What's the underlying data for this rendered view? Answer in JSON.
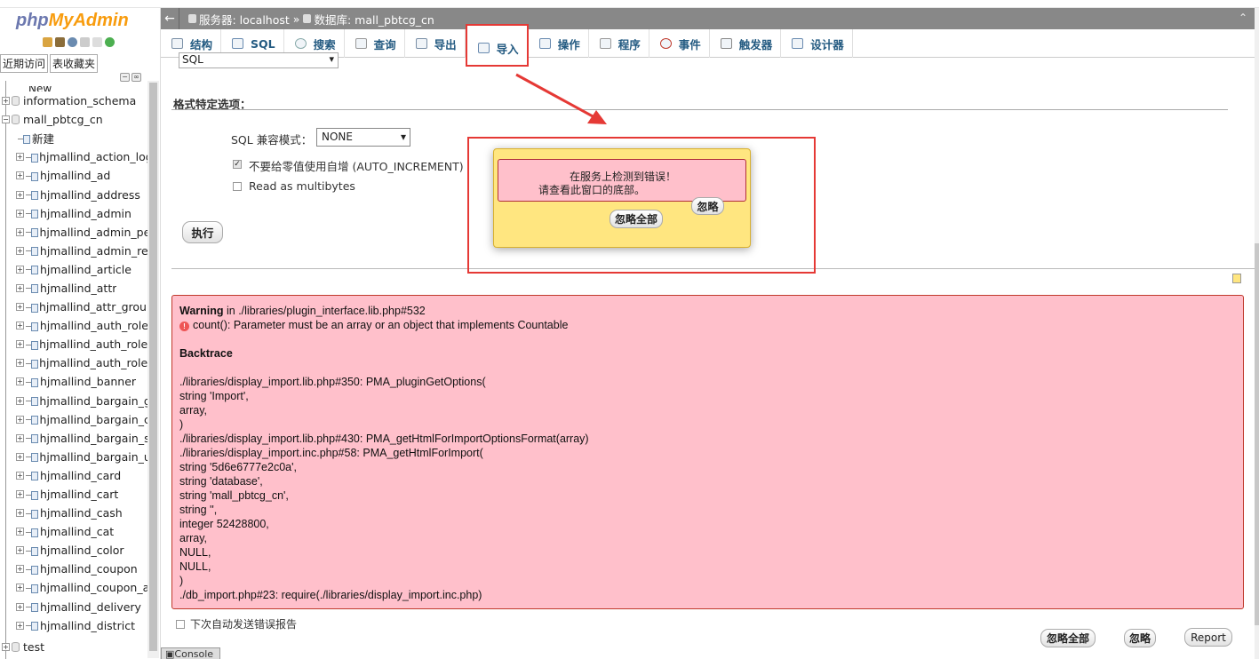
{
  "logo": {
    "php": "php",
    "my": "MyAdmin"
  },
  "colors": {
    "accent": "#235a81",
    "error_bg": "#ffc0cb",
    "popup_bg": "#ffe680",
    "highlight": "#e53935"
  },
  "sidebar": {
    "tabs": [
      "近期访问",
      "表收藏夹"
    ],
    "partial_top": "New",
    "db_info_schema": "information_schema",
    "db_current": "mall_pbtcg_cn",
    "new_label": "新建",
    "tables": [
      "hjmallind_action_log",
      "hjmallind_ad",
      "hjmallind_address",
      "hjmallind_admin",
      "hjmallind_admin_pe",
      "hjmallind_admin_re",
      "hjmallind_article",
      "hjmallind_attr",
      "hjmallind_attr_group",
      "hjmallind_auth_role",
      "hjmallind_auth_role_",
      "hjmallind_auth_role_",
      "hjmallind_banner",
      "hjmallind_bargain_g",
      "hjmallind_bargain_c",
      "hjmallind_bargain_s",
      "hjmallind_bargain_u",
      "hjmallind_card",
      "hjmallind_cart",
      "hjmallind_cash",
      "hjmallind_cat",
      "hjmallind_color",
      "hjmallind_coupon",
      "hjmallind_coupon_a",
      "hjmallind_delivery",
      "hjmallind_district"
    ],
    "db_test": "test"
  },
  "breadcrumb": {
    "server": "服务器: localhost",
    "sep": "»",
    "database": "数据库: mall_pbtcg_cn"
  },
  "tabs": [
    {
      "label": "结构",
      "icon": "structure-icon"
    },
    {
      "label": "SQL",
      "icon": "sql-icon"
    },
    {
      "label": "搜索",
      "icon": "search-icon"
    },
    {
      "label": "查询",
      "icon": "query-icon"
    },
    {
      "label": "导出",
      "icon": "export-icon"
    },
    {
      "label": "导入",
      "icon": "import-icon"
    },
    {
      "label": "操作",
      "icon": "wrench-icon"
    },
    {
      "label": "程序",
      "icon": "routines-icon"
    },
    {
      "label": "事件",
      "icon": "events-icon"
    },
    {
      "label": "触发器",
      "icon": "triggers-icon"
    },
    {
      "label": "设计器",
      "icon": "designer-icon"
    }
  ],
  "active_tab": "导入",
  "import": {
    "format_value": "SQL",
    "format_options_title": "格式特定选项：",
    "sql_compat_label": "SQL 兼容模式：",
    "sql_compat_value": "NONE",
    "no_auto_inc_label": "不要给零值使用自增 (AUTO_INCREMENT)",
    "no_auto_inc_checked": true,
    "multibytes_label": "Read as multibytes",
    "multibytes_checked": false,
    "go_button": "执行"
  },
  "popup": {
    "line1": "在服务上检测到错误！",
    "line2": "请查看此窗口的底部。",
    "ignore": "忽略",
    "ignore_all": "忽略全部"
  },
  "warning": {
    "title": "Warning",
    "location": " in ./libraries/plugin_interface.lib.php#532",
    "message": "count(): Parameter must be an array or an object that implements Countable",
    "backtrace_title": "Backtrace",
    "lines": [
      "./libraries/display_import.lib.php#350: PMA_pluginGetOptions(",
      "string 'Import',",
      "array,",
      ")",
      "./libraries/display_import.lib.php#430: PMA_getHtmlForImportOptionsFormat(array)",
      "./libraries/display_import.inc.php#58: PMA_getHtmlForImport(",
      "string '5d6e6777e2c0a',",
      "string 'database',",
      "string 'mall_pbtcg_cn',",
      "string '',",
      "integer 52428800,",
      "array,",
      "NULL,",
      "NULL,",
      ")",
      "./db_import.php#23: require(./libraries/display_import.inc.php)"
    ]
  },
  "footer": {
    "auto_report_label": "下次自动发送错误报告",
    "ignore_all": "忽略全部",
    "ignore": "忽略",
    "report": "Report",
    "console_tab": "Console"
  }
}
